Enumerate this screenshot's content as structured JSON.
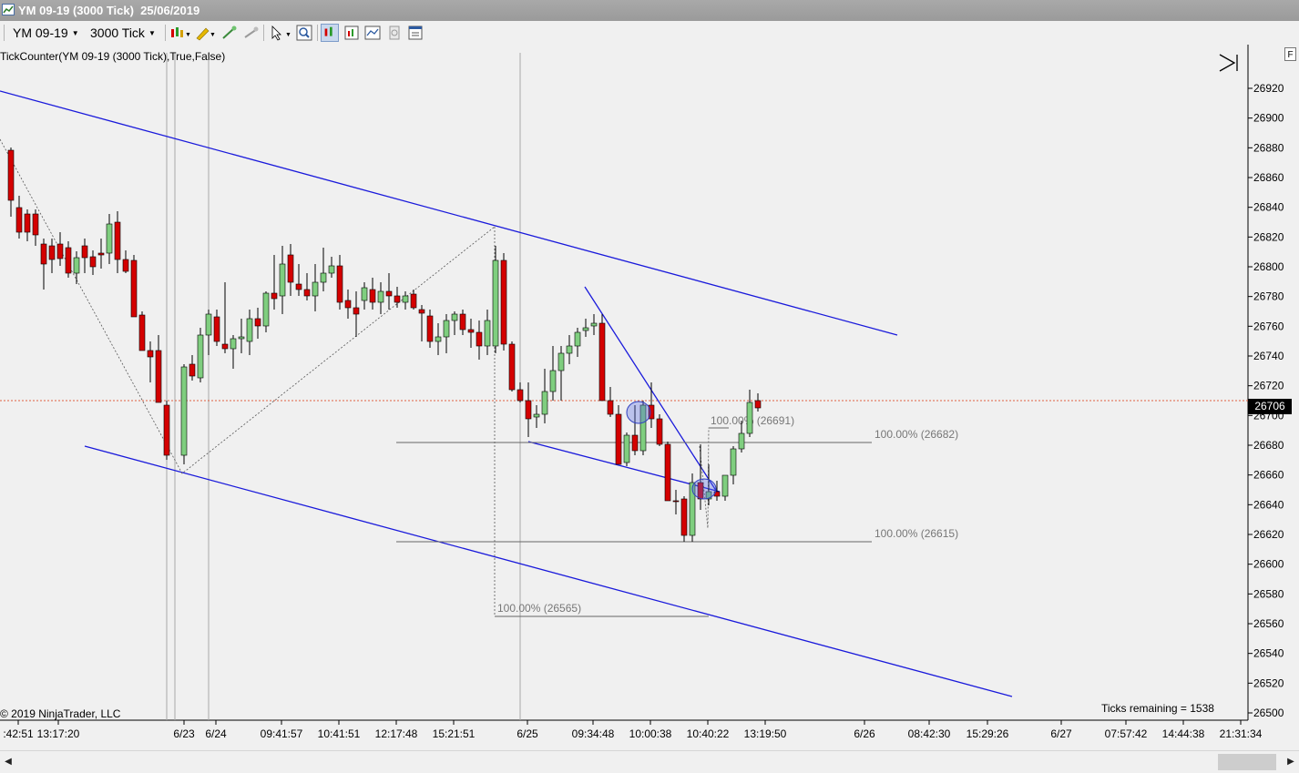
{
  "window": {
    "title": "YM 09-19 (3000 Tick)  25/06/2019"
  },
  "toolbar": {
    "instrument": "YM 09-19",
    "interval": "3000 Tick",
    "buttons": [
      "bar-type-icon",
      "drawing-pencil-icon",
      "drawing-tools-icon",
      "trade-icon",
      "pointer-icon",
      "zoom-icon",
      "chart-style-icon",
      "data-box-icon",
      "indicators-icon",
      "strategies-icon",
      "properties-icon"
    ]
  },
  "chart": {
    "indicator_label": "TickCounter(YM 09-19 (3000 Tick),True,False)",
    "copyright": "© 2019 NinjaTrader, LLC",
    "ticks_remaining": "Ticks remaining = 1538",
    "current_price": "26706",
    "f_button": "F",
    "price_axis": [
      "26920",
      "26900",
      "26880",
      "26860",
      "26840",
      "26820",
      "26800",
      "26780",
      "26760",
      "26740",
      "26720",
      "26700",
      "26680",
      "26660",
      "26640",
      "26620",
      "26600",
      "26580",
      "26560",
      "26540",
      "26520",
      "26500"
    ],
    "time_axis": [
      ":42:51",
      "13:17:20",
      "6/23",
      "6/24",
      "09:41:57",
      "10:41:51",
      "12:17:48",
      "15:21:51",
      "6/25",
      "09:34:48",
      "10:00:38",
      "10:40:22",
      "13:19:50",
      "6/26",
      "08:42:30",
      "15:29:26",
      "6/27",
      "07:57:42",
      "14:44:38",
      "21:31:34"
    ],
    "fib_labels": [
      "100.00% (26691)",
      "100.00% (26682)",
      "100.00% (26615)",
      "100.00% (26565)"
    ],
    "colors": {
      "up": "#7fce7f",
      "down": "#d40000",
      "channel": "#1a1adb",
      "price_line": "#e06040",
      "background": "#f0f0f0"
    }
  }
}
